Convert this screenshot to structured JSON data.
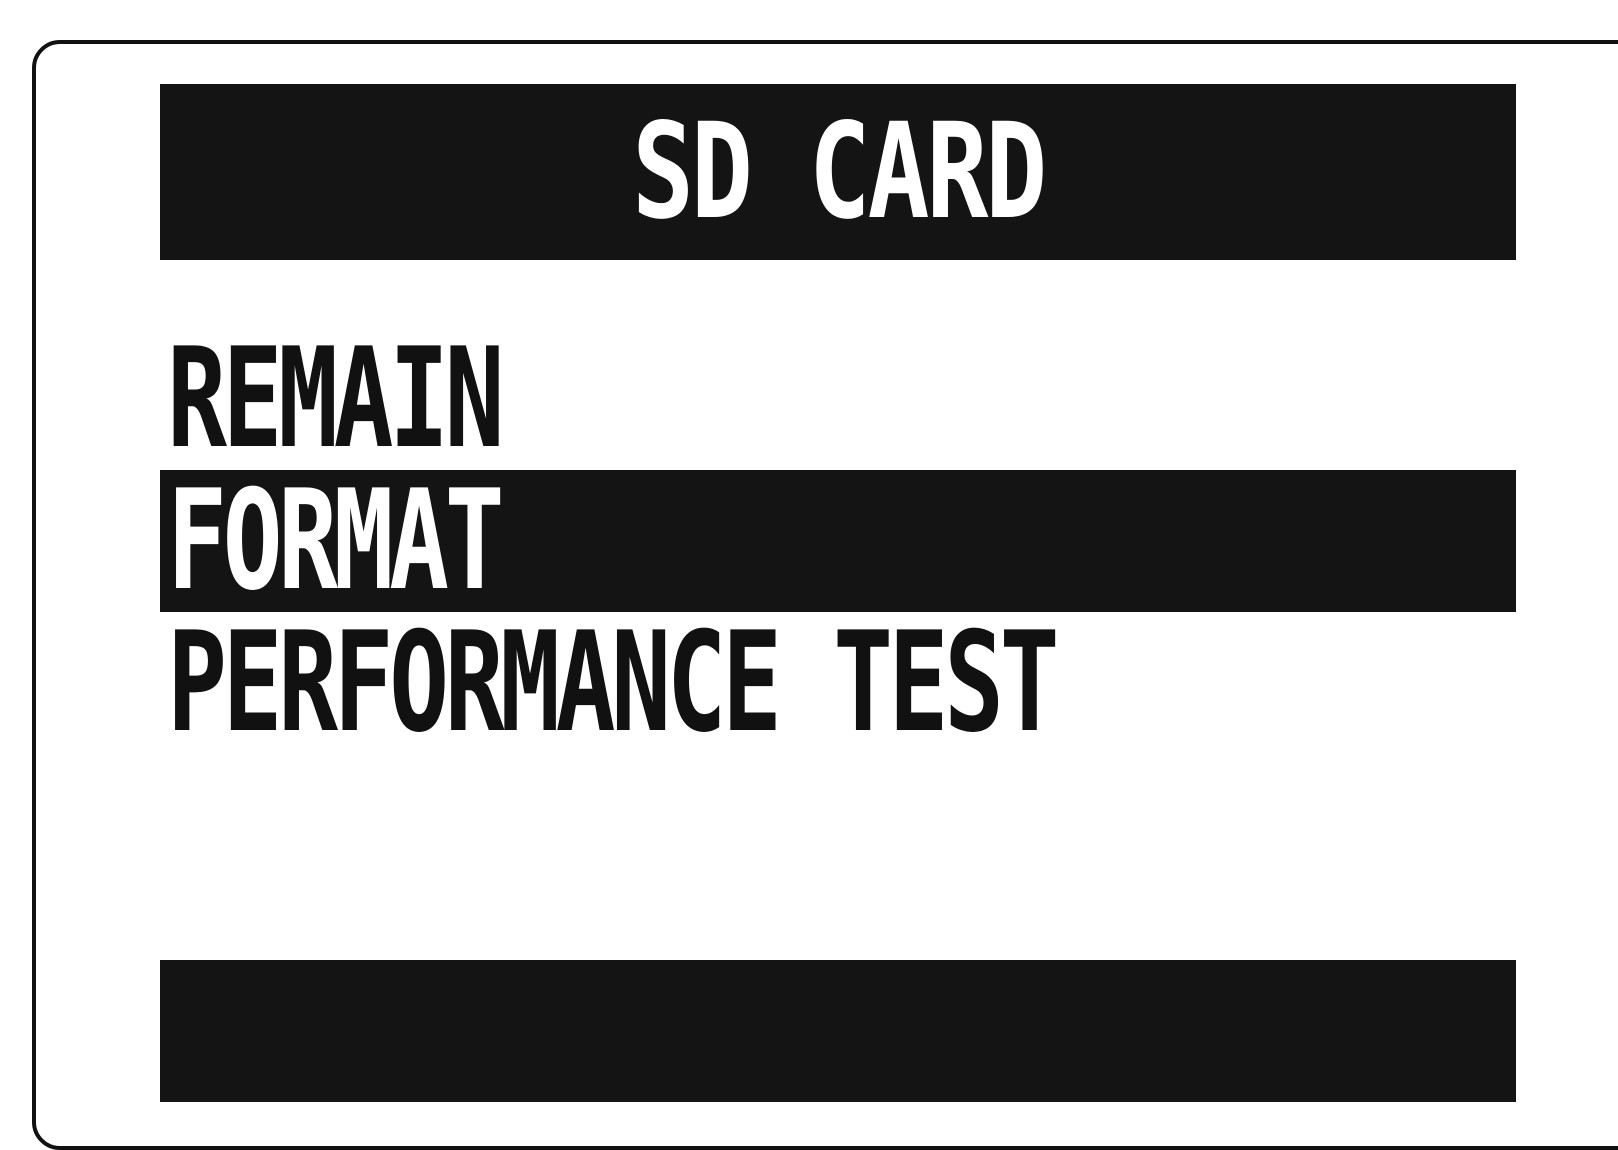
{
  "header": {
    "title": "SD CARD"
  },
  "menu": {
    "items": [
      {
        "label": "REMAIN",
        "selected": false
      },
      {
        "label": "FORMAT",
        "selected": true
      },
      {
        "label": "PERFORMANCE TEST",
        "selected": false
      }
    ]
  },
  "footer": {
    "text": ""
  },
  "colors": {
    "background": "#ffffff",
    "foreground": "#141414",
    "highlight_text": "#ffffff"
  }
}
